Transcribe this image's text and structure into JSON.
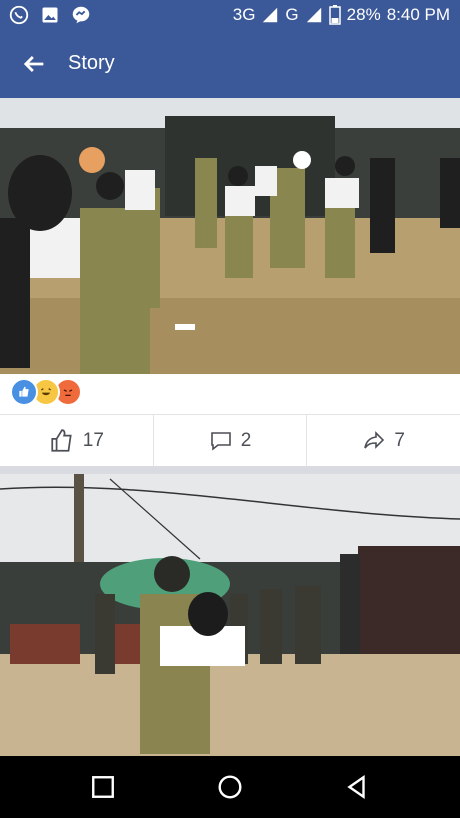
{
  "status_bar": {
    "network": "3G",
    "carrier_signal": "G",
    "battery": "28%",
    "time": "8:40 PM",
    "left_icons": [
      "whatsapp-icon",
      "image-icon",
      "messenger-icon"
    ]
  },
  "app_bar": {
    "back_icon": "arrow-left-icon",
    "title": "Story"
  },
  "post": {
    "reactions": [
      "like",
      "haha",
      "angry"
    ],
    "reaction_colors": {
      "like": "#4a90e2",
      "haha": "#f7c744",
      "angry": "#f06b3b"
    },
    "actions": {
      "likes": "17",
      "comments": "2",
      "shares": "7"
    }
  },
  "nav_bar": {
    "buttons": [
      "recent-apps-icon",
      "home-icon",
      "back-icon"
    ]
  },
  "colors": {
    "brand": "#3b5998",
    "text_muted": "#4b4f56"
  }
}
